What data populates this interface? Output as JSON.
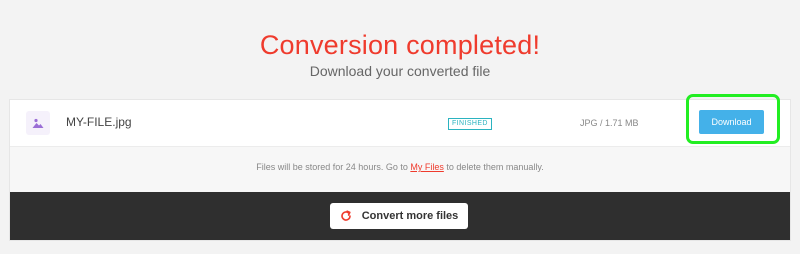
{
  "header": {
    "title": "Conversion completed!",
    "subtitle": "Download your converted file"
  },
  "file": {
    "name": "MY-FILE.jpg",
    "status": "FINISHED",
    "meta": "JPG / 1.71 MB",
    "icon": "image-file-icon",
    "download_label": "Download"
  },
  "notice": {
    "before": "Files will be stored for 24 hours. Go to ",
    "link": "My Files",
    "after": " to delete them manually."
  },
  "actions": {
    "convert_more_label": "Convert more files",
    "convert_more_icon": "refresh-icon"
  },
  "colors": {
    "accent_red": "#ef3b2d",
    "download_blue": "#44b1e9",
    "status_teal": "#2bb3c0",
    "highlight_green": "#22ee22",
    "dark_bar": "#2f2f2f"
  }
}
